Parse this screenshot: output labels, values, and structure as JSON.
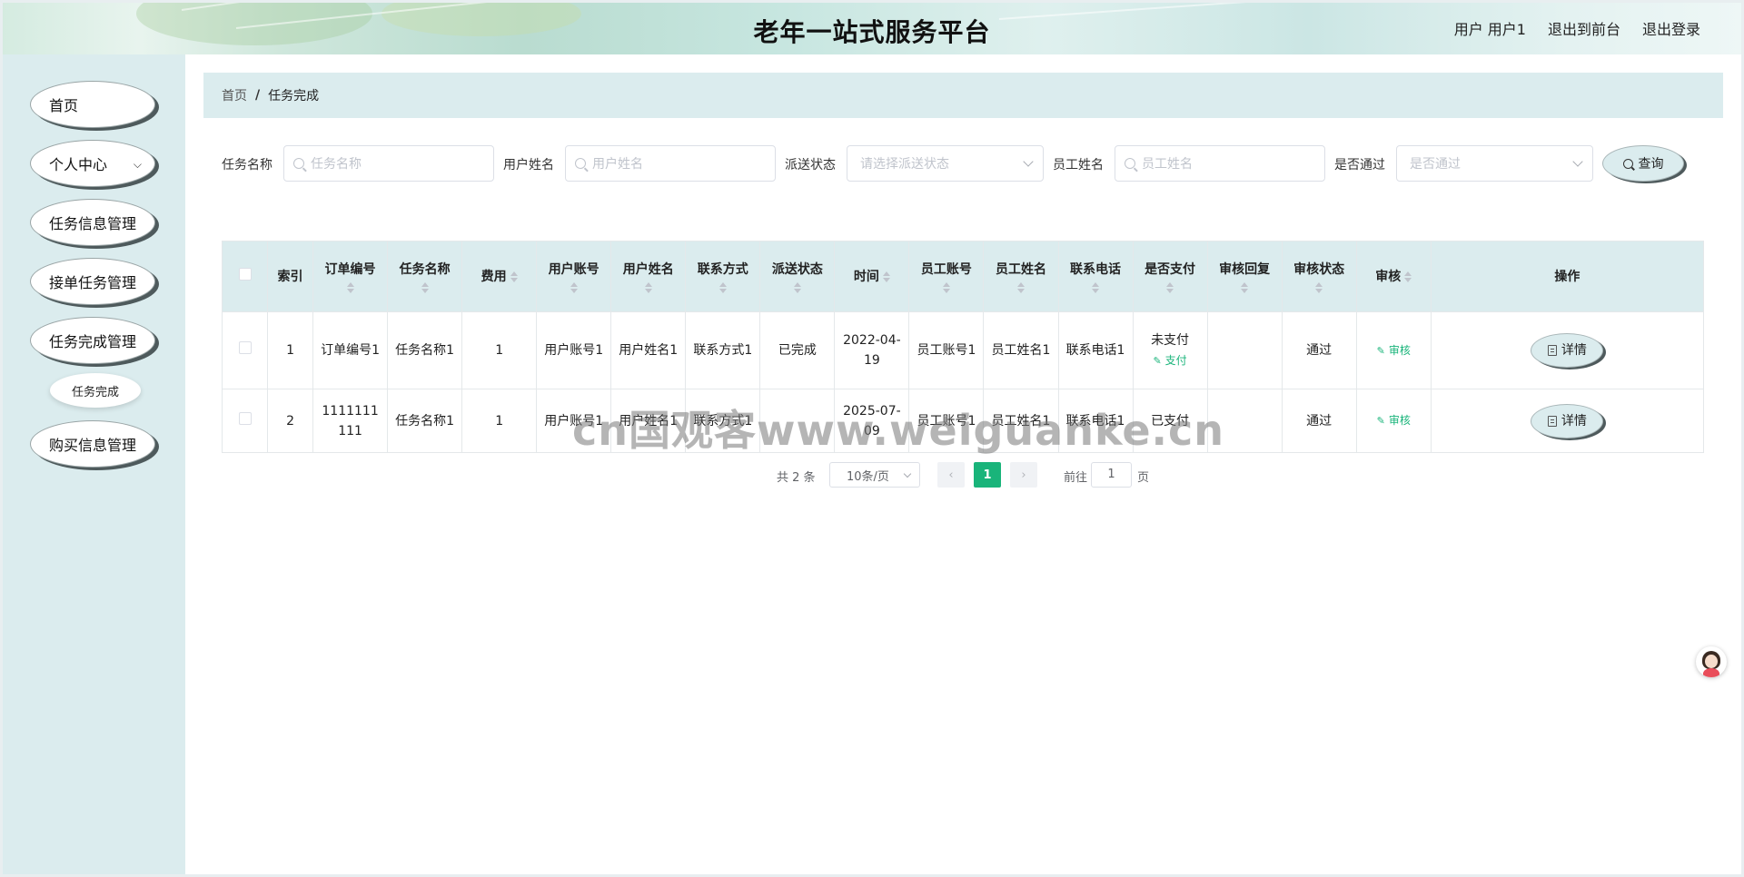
{
  "header": {
    "title": "老年一站式服务平台",
    "user_label": "用户 用户1",
    "exit_front": "退出到前台",
    "logout": "退出登录"
  },
  "sidebar": {
    "items": [
      {
        "label": "首页"
      },
      {
        "label": "个人中心"
      },
      {
        "label": "任务信息管理"
      },
      {
        "label": "接单任务管理"
      },
      {
        "label": "任务完成管理"
      },
      {
        "label": "购买信息管理"
      }
    ],
    "sub_items": [
      {
        "label": "任务完成"
      }
    ]
  },
  "breadcrumb": {
    "home": "首页",
    "separator": "/",
    "current": "任务完成"
  },
  "search": {
    "task_name": {
      "label": "任务名称",
      "placeholder": "任务名称"
    },
    "user_name": {
      "label": "用户姓名",
      "placeholder": "用户姓名"
    },
    "dispatch_status": {
      "label": "派送状态",
      "placeholder": "请选择派送状态"
    },
    "staff_name": {
      "label": "员工姓名",
      "placeholder": "员工姓名"
    },
    "passed": {
      "label": "是否通过",
      "placeholder": "是否通过"
    },
    "query_button": "查询"
  },
  "table": {
    "columns": [
      "索引",
      "订单编号",
      "任务名称",
      "费用",
      "用户账号",
      "用户姓名",
      "联系方式",
      "派送状态",
      "时间",
      "员工账号",
      "员工姓名",
      "联系电话",
      "是否支付",
      "审核回复",
      "审核状态",
      "审核",
      "操作"
    ],
    "rows": [
      {
        "index": "1",
        "order_no": "订单编号1",
        "task_name": "任务名称1",
        "fee": "1",
        "user_account": "用户账号1",
        "user_name": "用户姓名1",
        "contact": "联系方式1",
        "dispatch_status": "已完成",
        "time": "2022-04-19",
        "staff_account": "员工账号1",
        "staff_name": "员工姓名1",
        "phone": "联系电话1",
        "paid": "未支付",
        "pay_link": "支付",
        "review_reply": "",
        "review_status": "通过",
        "review_link": "审核",
        "detail_button": "详情"
      },
      {
        "index": "2",
        "order_no": "1111111111",
        "task_name": "任务名称1",
        "fee": "1",
        "user_account": "用户账号1",
        "user_name": "用户姓名1",
        "contact": "联系方式1",
        "dispatch_status": "",
        "time": "2025-07-09",
        "staff_account": "员工账号1",
        "staff_name": "员工姓名1",
        "phone": "联系电话1",
        "paid": "已支付",
        "pay_link": "",
        "review_reply": "",
        "review_status": "通过",
        "review_link": "审核",
        "detail_button": "详情"
      }
    ]
  },
  "pagination": {
    "total": "共 2 条",
    "page_size": "10条/页",
    "prev": "‹",
    "current": "1",
    "next": "›",
    "goto_prefix": "前往",
    "goto_value": "1",
    "goto_suffix": "页"
  },
  "watermark": "cn国观客www.weiguanke.cn",
  "colors": {
    "accent": "#19b47a",
    "panel": "#dbecee",
    "shadow": "#4e5a5c"
  }
}
